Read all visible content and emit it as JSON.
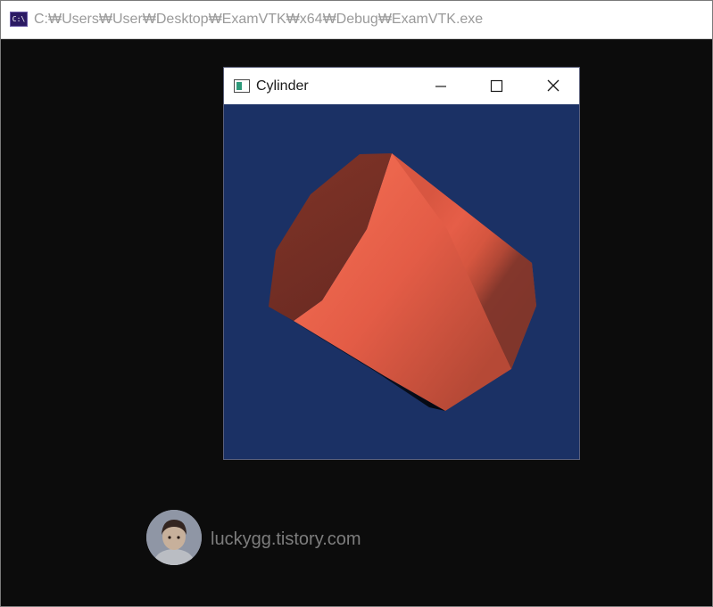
{
  "console": {
    "title": "C:₩Users₩User₩Desktop₩ExamVTK₩x64₩Debug₩ExamVTK.exe",
    "icon": "console-app-icon",
    "icon_text": "C:\\"
  },
  "render_window": {
    "title": "Cylinder",
    "icon": "window-app-icon",
    "controls": {
      "minimize_icon": "minimize-icon",
      "maximize_icon": "maximize-icon",
      "close_icon": "close-icon"
    },
    "background_color": "#1b3165",
    "object": {
      "shape": "cylinder",
      "color": "#e05a45"
    }
  },
  "watermark": {
    "text": "luckygg.tistory.com",
    "icon": "avatar"
  }
}
